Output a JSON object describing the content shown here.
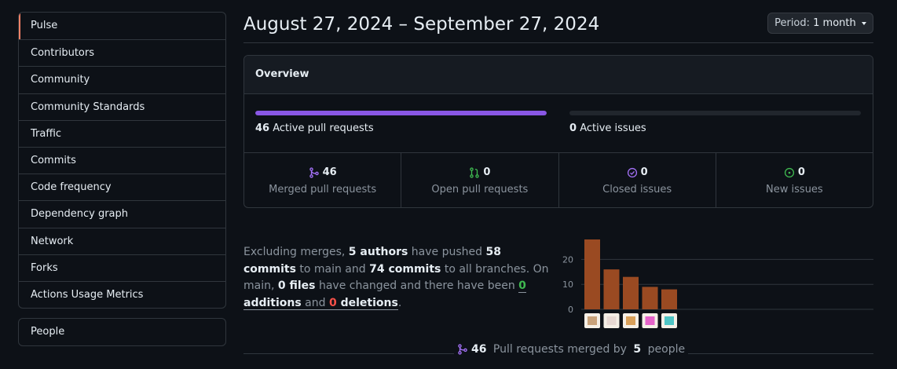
{
  "sidebar": {
    "items": [
      {
        "label": "Pulse"
      },
      {
        "label": "Contributors"
      },
      {
        "label": "Community"
      },
      {
        "label": "Community Standards"
      },
      {
        "label": "Traffic"
      },
      {
        "label": "Commits"
      },
      {
        "label": "Code frequency"
      },
      {
        "label": "Dependency graph"
      },
      {
        "label": "Network"
      },
      {
        "label": "Forks"
      },
      {
        "label": "Actions Usage Metrics"
      }
    ],
    "secondary": {
      "label": "People"
    }
  },
  "header": {
    "date_range": "August 27, 2024 – September 27, 2024",
    "period_prefix": "Period:",
    "period_value": "1 month"
  },
  "overview": {
    "title": "Overview",
    "active_prs": {
      "count": "46",
      "label": "Active pull requests",
      "fill": 1.0
    },
    "active_issues": {
      "count": "0",
      "label": "Active issues",
      "fill": 0.0
    },
    "stats": [
      {
        "count": "46",
        "label": "Merged pull requests",
        "icon": "merged-icon",
        "color": "#a371f7"
      },
      {
        "count": "0",
        "label": "Open pull requests",
        "icon": "pull-request-icon",
        "color": "#3fb950"
      },
      {
        "count": "0",
        "label": "Closed issues",
        "icon": "issue-closed-icon",
        "color": "#a371f7"
      },
      {
        "count": "0",
        "label": "New issues",
        "icon": "issue-opened-icon",
        "color": "#3fb950"
      }
    ]
  },
  "summary": {
    "t1": "Excluding merges, ",
    "authors": "5 authors",
    "t2": " have pushed ",
    "commits_main": "58 commits",
    "t3": " to main and ",
    "commits_all": "74 commits",
    "t4": " to all branches. On main, ",
    "files": "0 files",
    "t5": " have changed and there have been ",
    "additions_num": "0",
    "additions_word": "additions",
    "t6": " and ",
    "deletions_num": "0",
    "deletions_word": "deletions",
    "t7": "."
  },
  "chart_data": {
    "type": "bar",
    "categories": [
      "author-1",
      "author-2",
      "author-3",
      "author-4",
      "author-5"
    ],
    "values": [
      28,
      16,
      13,
      9,
      8
    ],
    "yticks": [
      0,
      10,
      20
    ],
    "ylim": [
      0,
      28
    ],
    "bar_color": "#9a4a22",
    "avatar_colors": [
      "#c9a27a",
      "#e8d9d3",
      "#d9a05a",
      "#e563c9",
      "#4fc4c4"
    ]
  },
  "footer": {
    "count": "46",
    "text1": " Pull requests merged by ",
    "people": "5",
    "text2": " people"
  }
}
